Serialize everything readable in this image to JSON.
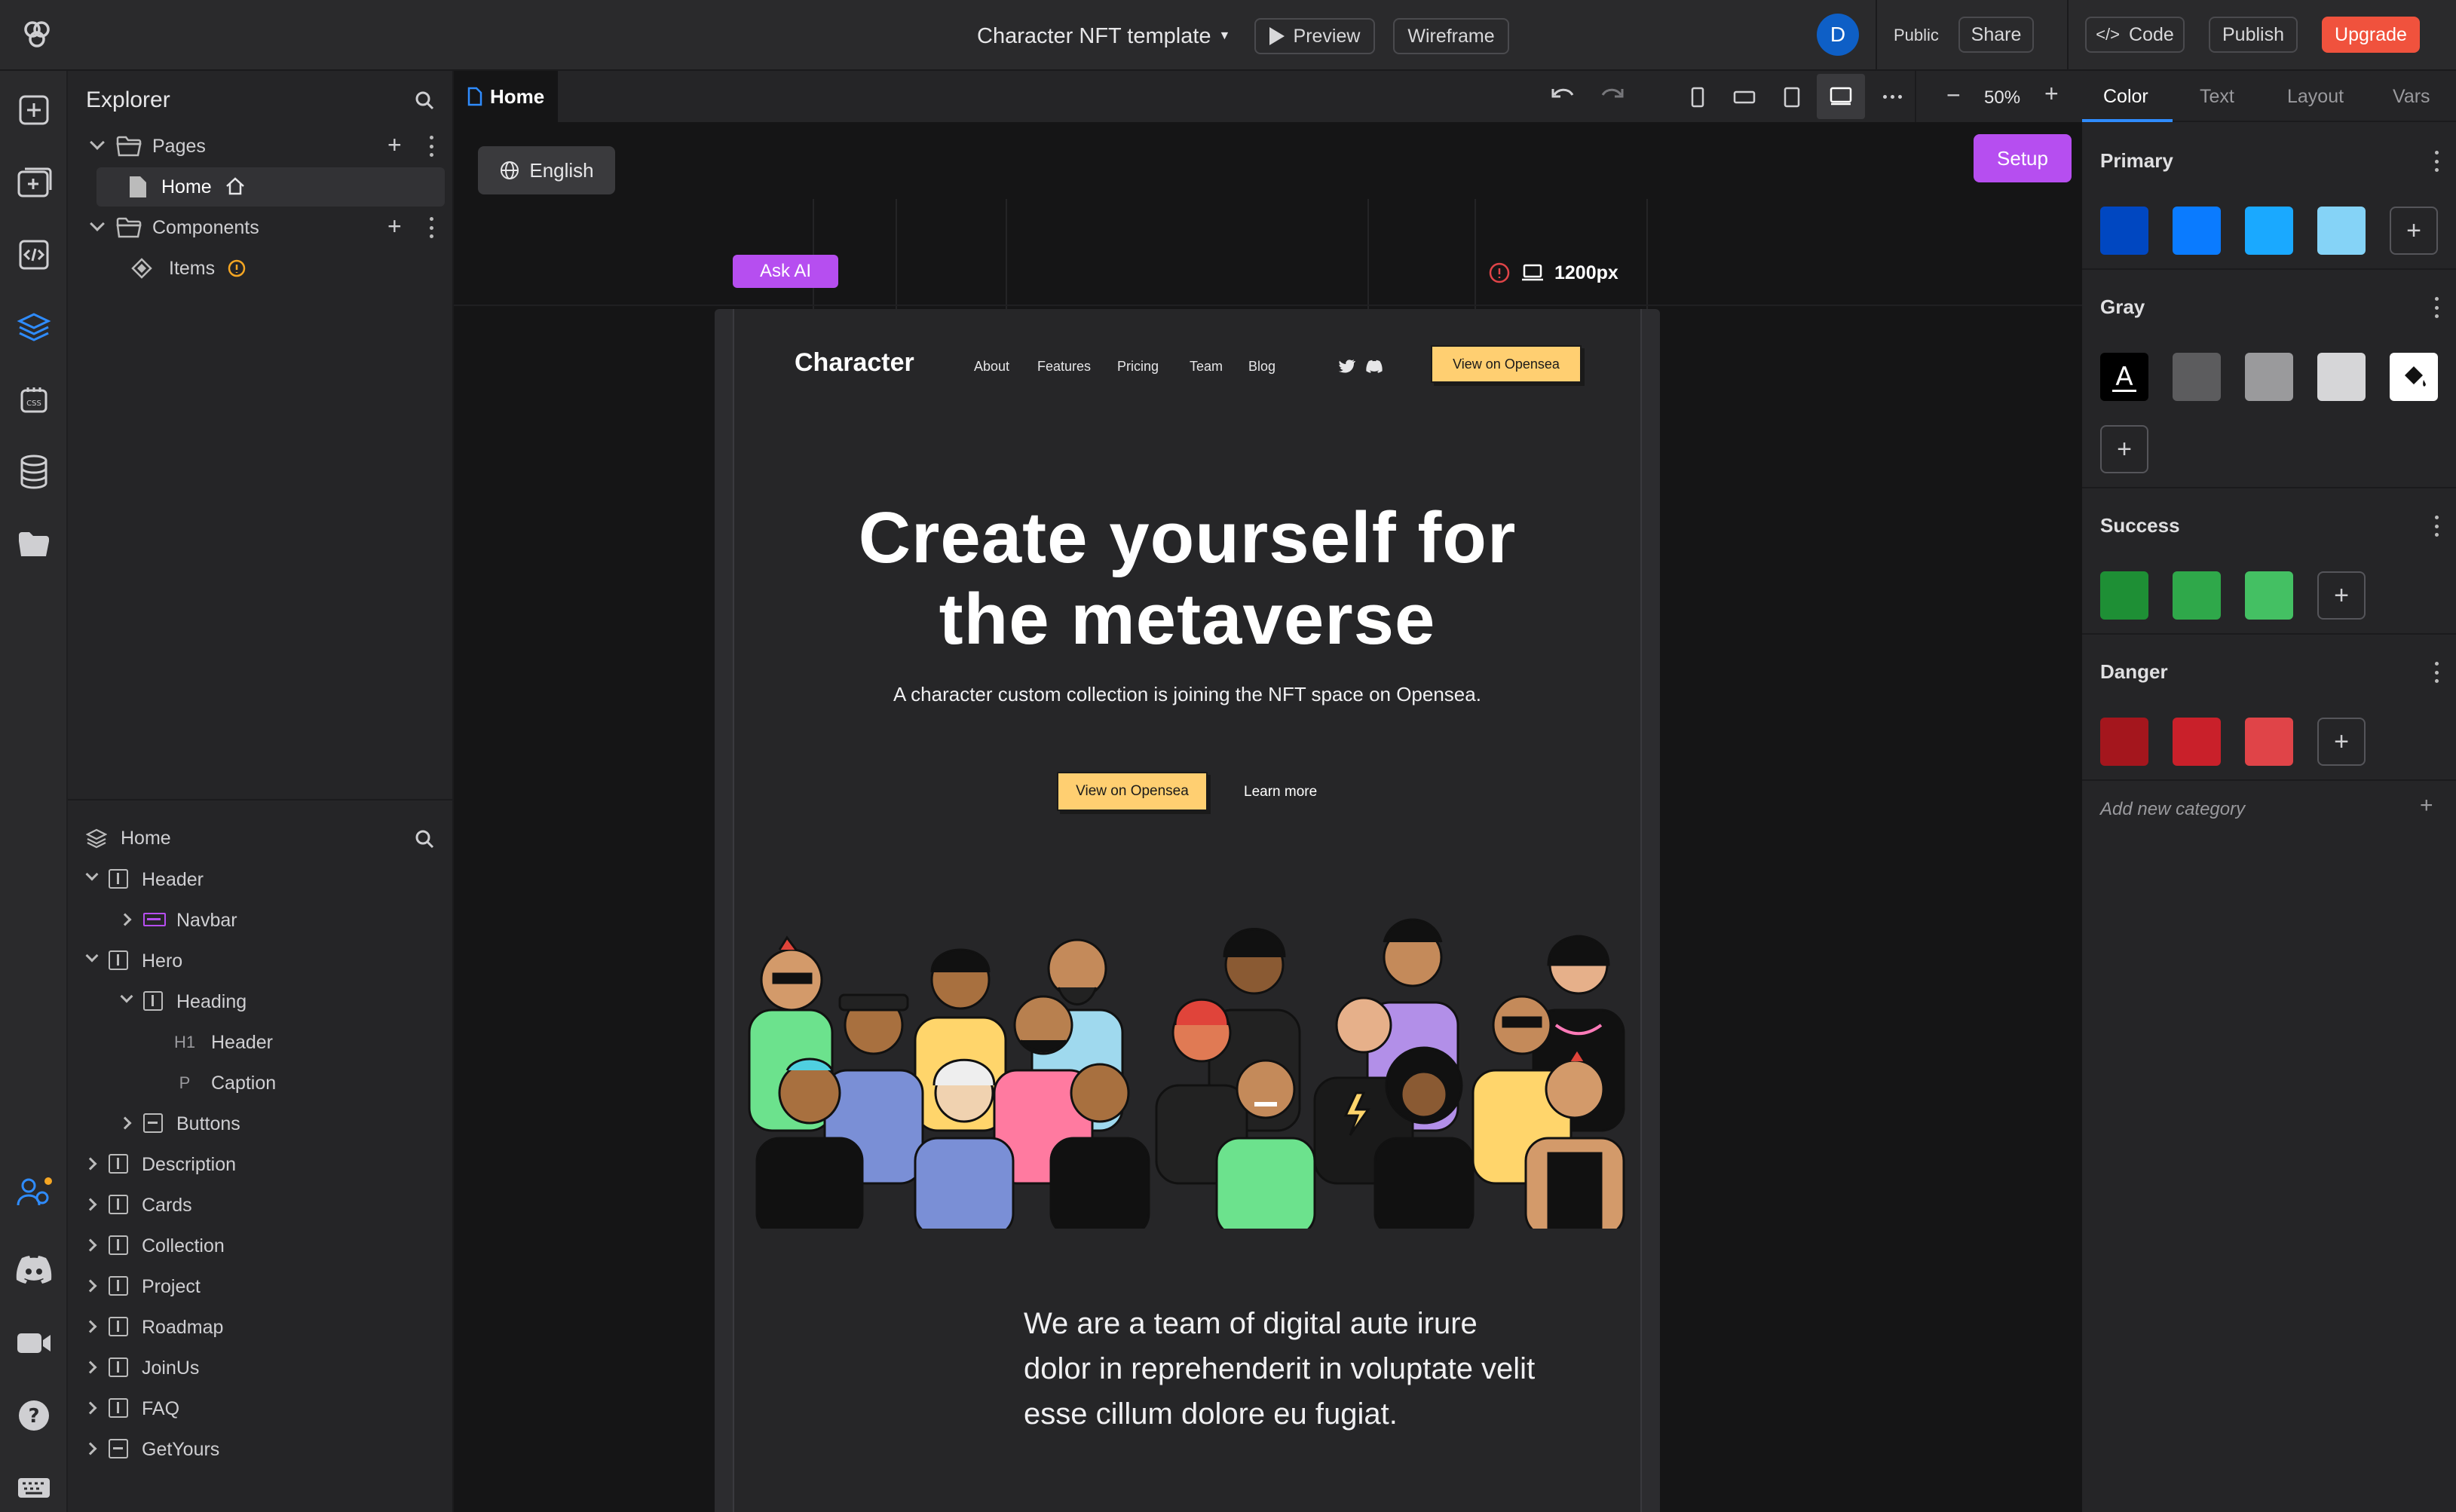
{
  "topbar": {
    "project_title": "Character NFT template",
    "preview_label": "Preview",
    "wireframe_label": "Wireframe",
    "avatar_letter": "D",
    "public_label": "Public",
    "share_label": "Share",
    "code_label": "Code",
    "publish_label": "Publish",
    "upgrade_label": "Upgrade"
  },
  "explorer": {
    "title": "Explorer",
    "pages_label": "Pages",
    "home_page_label": "Home",
    "components_label": "Components",
    "items_label": "Items"
  },
  "layers": {
    "root_label": "Home",
    "nodes": [
      {
        "label": "Header",
        "tag": ""
      },
      {
        "label": "Navbar",
        "tag": ""
      },
      {
        "label": "Hero",
        "tag": ""
      },
      {
        "label": "Heading",
        "tag": ""
      },
      {
        "label": "Header",
        "tag": "H1"
      },
      {
        "label": "Caption",
        "tag": "P"
      },
      {
        "label": "Buttons",
        "tag": ""
      },
      {
        "label": "Description",
        "tag": ""
      },
      {
        "label": "Cards",
        "tag": ""
      },
      {
        "label": "Collection",
        "tag": ""
      },
      {
        "label": "Project",
        "tag": ""
      },
      {
        "label": "Roadmap",
        "tag": ""
      },
      {
        "label": "JoinUs",
        "tag": ""
      },
      {
        "label": "FAQ",
        "tag": ""
      },
      {
        "label": "GetYours",
        "tag": ""
      }
    ]
  },
  "canvas": {
    "tab_label": "Home",
    "zoom": "50%",
    "language_label": "English",
    "setup_label": "Setup",
    "ask_ai_label": "Ask AI",
    "breakpoint_label": "1200px"
  },
  "site": {
    "brand": "Character",
    "nav": [
      "About",
      "Features",
      "Pricing",
      "Team",
      "Blog"
    ],
    "cta_label": "View on Opensea",
    "hero_line1": "Create yourself for",
    "hero_line2": "the metaverse",
    "hero_caption": "A character custom collection is joining the NFT space on Opensea.",
    "primary_button": "View on Opensea",
    "secondary_button": "Learn more",
    "description_line1": "We are a team of digital aute irure",
    "description_line2": "dolor in reprehenderit in voluptate velit",
    "description_line3": "esse cillum dolore eu fugiat."
  },
  "right_panel": {
    "tabs": [
      "Color",
      "Text",
      "Layout",
      "Vars"
    ],
    "active_tab": "Color",
    "categories": [
      {
        "name": "Primary",
        "colors": [
          "#0047c1",
          "#0a7bff",
          "#1aa9ff",
          "#85d3f7"
        ]
      },
      {
        "name": "Gray",
        "colors": [
          "#000000",
          "#5c5c5e",
          "#9a9a9c",
          "#d6d6d8",
          "#ffffff"
        ]
      },
      {
        "name": "Success",
        "colors": [
          "#1e8f35",
          "#2fa84a",
          "#44c063"
        ]
      },
      {
        "name": "Danger",
        "colors": [
          "#a4161d",
          "#c9202a",
          "#e04448"
        ]
      }
    ],
    "add_category_label": "Add new category"
  },
  "colors": {
    "accent_purple": "#b64ef0",
    "cta_yellow": "#ffcf71",
    "upgrade_red": "#f0523d",
    "avatar_blue": "#0e5fc6"
  }
}
